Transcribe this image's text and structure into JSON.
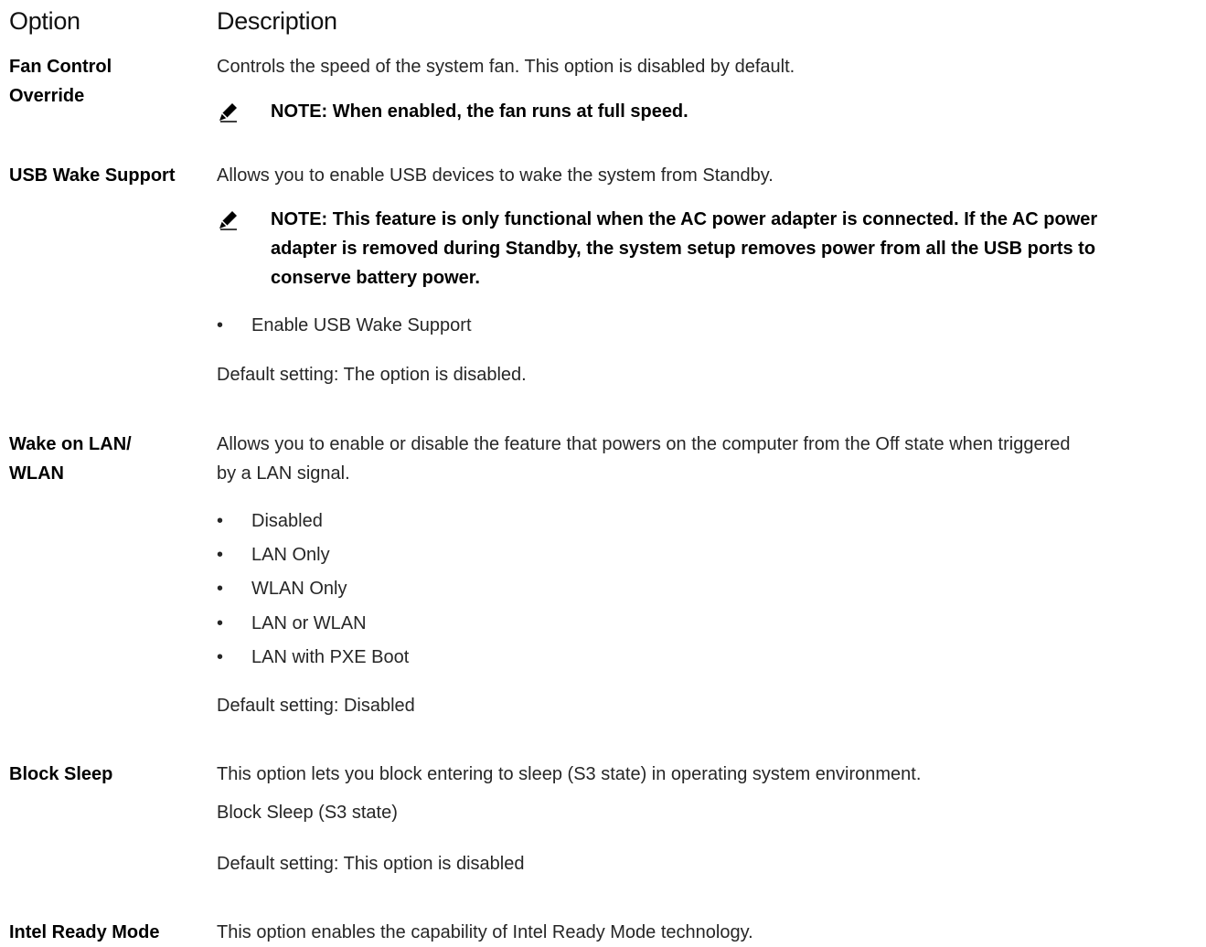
{
  "header": {
    "col1": "Option",
    "col2": "Description"
  },
  "fan": {
    "label_line1": "Fan Control",
    "label_line2": "Override",
    "desc": "Controls the speed of the system fan. This option is disabled by default.",
    "note": "NOTE: When enabled, the fan runs at full speed."
  },
  "usb": {
    "label": "USB Wake Support",
    "desc": "Allows you to enable USB devices to wake the system from Standby.",
    "note_line1": "NOTE: This feature is only functional when the AC power adapter is connected. If the AC power",
    "note_line2": "adapter is removed during Standby, the system setup removes power from all the USB ports to",
    "note_line3": "conserve battery power.",
    "bullets": [
      "Enable USB Wake Support"
    ],
    "default": "Default setting: The option is disabled."
  },
  "wol": {
    "label_line1": "Wake on LAN/",
    "label_line2": "WLAN",
    "desc_line1": "Allows you to enable or disable the feature that powers on the computer from the Off state when triggered",
    "desc_line2": "by a LAN signal.",
    "bullets": [
      "Disabled",
      "LAN Only",
      "WLAN Only",
      "LAN or WLAN",
      "LAN with PXE Boot"
    ],
    "default": "Default setting: Disabled"
  },
  "block_sleep": {
    "label": "Block Sleep",
    "desc": "This option lets you block entering to sleep (S3 state) in operating system environment.",
    "sub": "Block Sleep (S3 state)",
    "default": "Default setting: This option is disabled"
  },
  "intel": {
    "label": "Intel Ready Mode",
    "desc": "This option enables the capability of Intel Ready Mode technology."
  },
  "bullet_char": "•"
}
